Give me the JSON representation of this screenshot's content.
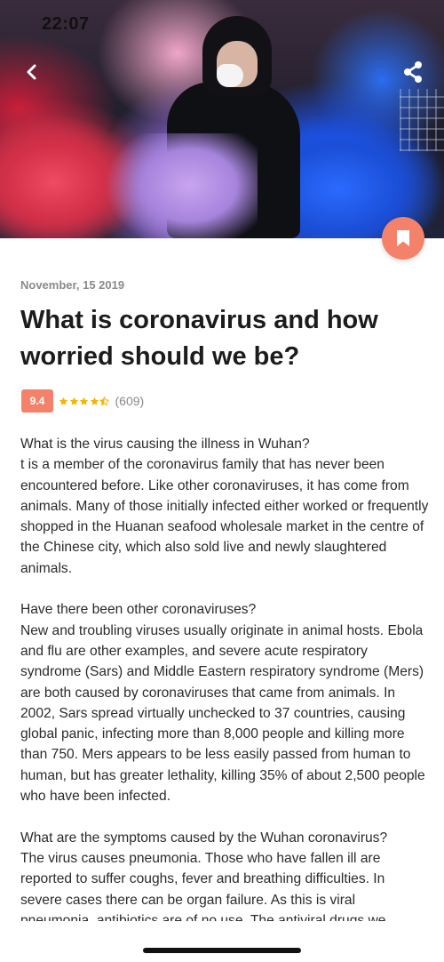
{
  "status_bar": {
    "time": "22:07"
  },
  "toolbar": {
    "back_icon": "chevron-left-icon",
    "share_icon": "share-icon",
    "bookmark_icon": "bookmark-icon"
  },
  "colors": {
    "accent": "#f4826a",
    "star": "#f5b400"
  },
  "article": {
    "date": "November, 15 2019",
    "title": "What is coronavirus and how worried should we be?",
    "score": "9.4",
    "stars": 4.5,
    "reviews": "(609)",
    "paragraphs": [
      {
        "heading": "What is the virus causing the illness in Wuhan?",
        "text": "t is a member of the coronavirus family that has never been encountered before. Like other coronaviruses, it has come from animals. Many of those initially infected either worked or frequently shopped in the Huanan seafood wholesale market in the centre of the Chinese city, which also sold live and newly slaughtered animals."
      },
      {
        "heading": "Have there been other coronaviruses?",
        "text": "New and troubling viruses usually originate in animal hosts. Ebola and flu are other examples, and severe acute respiratory syndrome (Sars) and Middle Eastern respiratory syndrome (Mers) are both caused by coronaviruses that came from animals. In 2002, Sars spread virtually unchecked to 37 countries, causing global panic, infecting more than 8,000 people and killing more than 750. Mers appears to be less easily passed from human to human, but has greater lethality, killing 35% of about 2,500 people who have been infected."
      },
      {
        "heading": "What are the symptoms caused by the Wuhan coronavirus?",
        "text": "The virus causes pneumonia. Those who have fallen ill are reported to suffer coughs, fever and breathing difficulties. In severe cases there can be organ failure. As this is viral pneumonia, antibiotics are of no use. The antiviral drugs we"
      }
    ]
  }
}
